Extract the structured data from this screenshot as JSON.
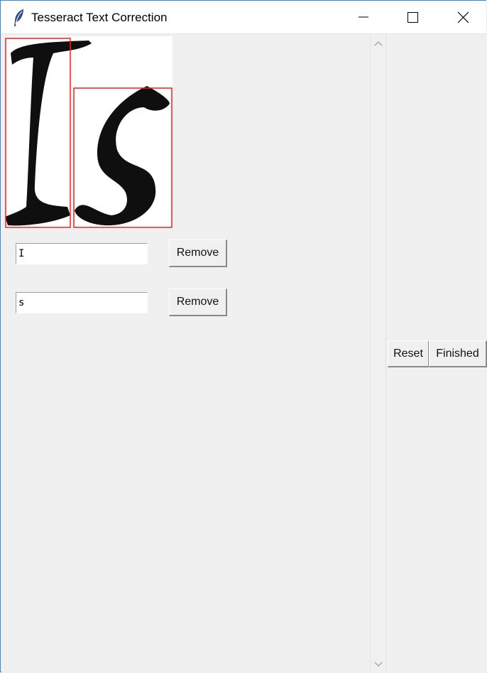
{
  "window": {
    "title": "Tesseract Text Correction",
    "app_icon": "feather-icon",
    "controls": [
      "minimize-icon",
      "maximize-icon",
      "close-icon"
    ]
  },
  "image_preview": {
    "characters": [
      "I",
      "s"
    ],
    "box_color": "#ff1a1a"
  },
  "entries": [
    {
      "value": "I",
      "remove_label": "Remove"
    },
    {
      "value": "s",
      "remove_label": "Remove"
    }
  ],
  "actions": {
    "reset_label": "Reset",
    "finished_label": "Finished"
  },
  "scrollbar": {
    "up_icon": "chevron-up-icon",
    "down_icon": "chevron-down-icon"
  }
}
